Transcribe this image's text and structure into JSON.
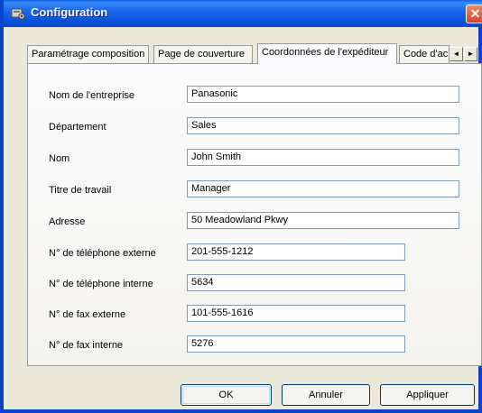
{
  "window": {
    "title": "Configuration"
  },
  "tabs": [
    {
      "label": "Paramétrage composition"
    },
    {
      "label": "Page de couverture"
    },
    {
      "label": "Coordonnées de l'expéditeur",
      "active": true
    },
    {
      "label": "Code d'ac"
    }
  ],
  "tab_scroll": {
    "left": "◄",
    "right": "►"
  },
  "form": {
    "fields": [
      {
        "label": "Nom de l'entreprise",
        "value": "Panasonic"
      },
      {
        "label": "Département",
        "value": "Sales"
      },
      {
        "label": "Nom",
        "value": "John Smith"
      },
      {
        "label": "Titre de travail",
        "value": "Manager"
      },
      {
        "label": "Adresse",
        "value": "50 Meadowland Pkwy"
      },
      {
        "label": "N° de téléphone externe",
        "value": "201-555-1212"
      },
      {
        "label": "N° de téléphone interne",
        "value": "5634"
      },
      {
        "label": "N° de fax externe",
        "value": "101-555-1616"
      },
      {
        "label": "N° de fax interne",
        "value": "5276"
      }
    ]
  },
  "buttons": {
    "ok": "OK",
    "cancel": "Annuler",
    "apply": "Appliquer"
  },
  "colors": {
    "titlebar": "#0a54dc",
    "close": "#d2452a",
    "window_bg": "#ece9d8",
    "field_border": "#7f9db9"
  }
}
